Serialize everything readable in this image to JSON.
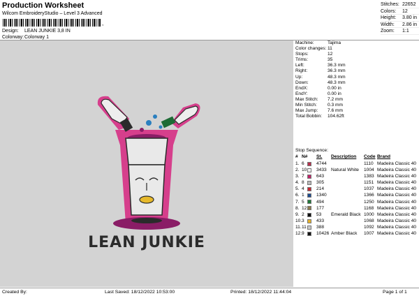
{
  "header": {
    "title": "Production Worksheet",
    "subtitle": "Wilcom EmbroideryStudio – Level 3 Advanced",
    "barcode_tail": ",",
    "design_label": "Design:",
    "design_value": "LEAN JUNKIE 3,8 IN",
    "colorway_label": "Colorway:",
    "colorway_value": "Colorway 1"
  },
  "stats": [
    {
      "k": "Stitches:",
      "v": "22652"
    },
    {
      "k": "Colors:",
      "v": "12"
    },
    {
      "k": "Height:",
      "v": "3.80 in"
    },
    {
      "k": "Width:",
      "v": "2.86 in"
    },
    {
      "k": "Zoom:",
      "v": "1:1"
    }
  ],
  "design": {
    "caption": "LEAN JUNKIE",
    "colors": {
      "background": "#d3d3d3",
      "outline_pink": "#d63f8c",
      "cup": "#e9e9e9",
      "dark": "#2b2b2b",
      "purple": "#8a1d66",
      "blue": "#2a7fbf",
      "green": "#1d6b35",
      "yellow": "#e7b92b"
    }
  },
  "info": [
    {
      "k": "Machine:",
      "v": "Tajima"
    },
    {
      "k": "Color changes:",
      "v": "11"
    },
    {
      "k": "Stops:",
      "v": "12"
    },
    {
      "k": "Trims:",
      "v": "35"
    },
    {
      "k": "Left:",
      "v": "36.3 mm"
    },
    {
      "k": "Right:",
      "v": "36.3 mm"
    },
    {
      "k": "Up:",
      "v": "48.3 mm"
    },
    {
      "k": "Down:",
      "v": "48.3 mm"
    },
    {
      "k": "EndX:",
      "v": "0.00 in"
    },
    {
      "k": "EndY:",
      "v": "0.00 in"
    },
    {
      "k": "Max Stitch:",
      "v": "7.2 mm"
    },
    {
      "k": "Min Stitch:",
      "v": "0.3 mm"
    },
    {
      "k": "Max Jump:",
      "v": "7.6 mm"
    },
    {
      "k": "Total Bobbin:",
      "v": "104.62ft"
    }
  ],
  "sequence": {
    "title": "Stop Sequence:",
    "headers": {
      "n": "#",
      "n2": "N#",
      "color": "",
      "st": "St.",
      "desc": "Description",
      "code": "Code",
      "brand": "Brand"
    },
    "rows": [
      {
        "n": "1.",
        "n2": "6",
        "color": "#b7324e",
        "thread": "4744",
        "desc": "",
        "st": "1110",
        "brand": "Madeira Classic 40"
      },
      {
        "n": "2.",
        "n2": "10",
        "color": "#f2f2f2",
        "thread": "3433",
        "desc": "Natural White",
        "st": "1004",
        "brand": "Madeira Classic 40"
      },
      {
        "n": "3.",
        "n2": "7",
        "color": "#c0256a",
        "thread": "643",
        "desc": "",
        "st": "1383",
        "brand": "Madeira Classic 40"
      },
      {
        "n": "4.",
        "n2": "8",
        "color": "#b9b9b9",
        "thread": "305",
        "desc": "",
        "st": "1151",
        "brand": "Madeira Classic 40"
      },
      {
        "n": "5.",
        "n2": "4",
        "color": "#c62732",
        "thread": "214",
        "desc": "",
        "st": "1037",
        "brand": "Madeira Classic 40"
      },
      {
        "n": "6.",
        "n2": "1",
        "color": "#1e4c8f",
        "thread": "1340",
        "desc": "",
        "st": "1366",
        "brand": "Madeira Classic 40"
      },
      {
        "n": "7.",
        "n2": "5",
        "color": "#1f7a3a",
        "thread": "494",
        "desc": "",
        "st": "1250",
        "brand": "Madeira Classic 40"
      },
      {
        "n": "8.",
        "n2": "12",
        "color": "#8d7a4c",
        "thread": "177",
        "desc": "",
        "st": "1168",
        "brand": "Madeira Classic 40"
      },
      {
        "n": "9.",
        "n2": "2",
        "color": "#111111",
        "thread": "53",
        "desc": "Emerald Black",
        "st": "1000",
        "brand": "Madeira Classic 40"
      },
      {
        "n": "10.",
        "n2": "3",
        "color": "#e5b22b",
        "thread": "433",
        "desc": "",
        "st": "1068",
        "brand": "Madeira Classic 40"
      },
      {
        "n": "11.",
        "n2": "11",
        "color": "#c9c9c9",
        "thread": "388",
        "desc": "",
        "st": "1092",
        "brand": "Madeira Classic 40"
      },
      {
        "n": "12.",
        "n2": "9",
        "color": "#141414",
        "thread": "10426",
        "desc": "Amber Black",
        "st": "1007",
        "brand": "Madeira Classic 40"
      }
    ]
  },
  "footer": {
    "created": "Created By:",
    "saved": "Last Saved: 18/12/2022 10:53:00",
    "printed": "Printed: 18/12/2022 11:44:04",
    "page": "Page 1 of 1"
  }
}
